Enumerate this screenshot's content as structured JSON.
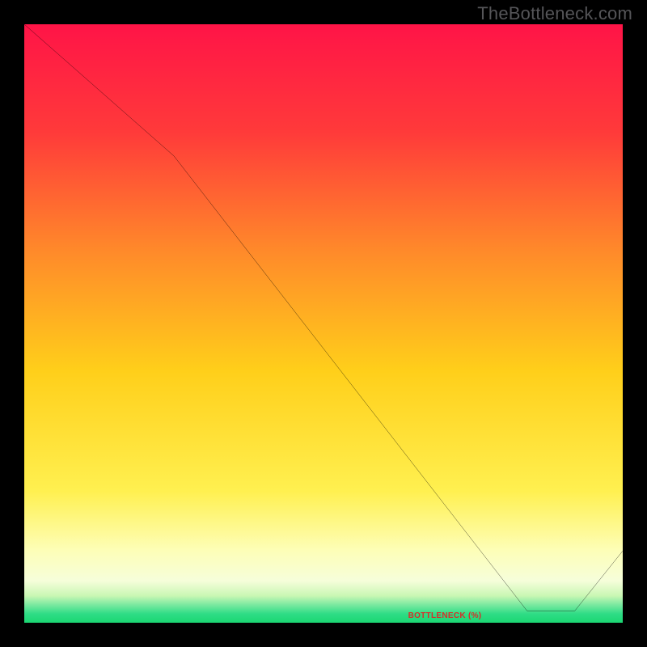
{
  "watermark": "TheBottleneck.com",
  "bottom_label": "BOTTLENECK (%)",
  "colors": {
    "top": "#ff1447",
    "mid_upper": "#ff7b2a",
    "mid": "#ffd21a",
    "mid_lower": "#fff57a",
    "pale": "#fdfecd",
    "green": "#1ee07a",
    "line": "#000000",
    "watermark": "#555558"
  },
  "chart_data": {
    "type": "line",
    "title": "",
    "xlabel": "",
    "ylabel": "",
    "xlim": [
      0,
      100
    ],
    "ylim": [
      0,
      100
    ],
    "x": [
      0,
      25,
      84,
      92,
      100
    ],
    "y": [
      100,
      78,
      2,
      2,
      12
    ],
    "notch": {
      "x_start": 84,
      "x_end": 92,
      "y": 2
    },
    "annotation": {
      "text": "BOTTLENECK (%)",
      "x": 88,
      "y": 2
    }
  }
}
